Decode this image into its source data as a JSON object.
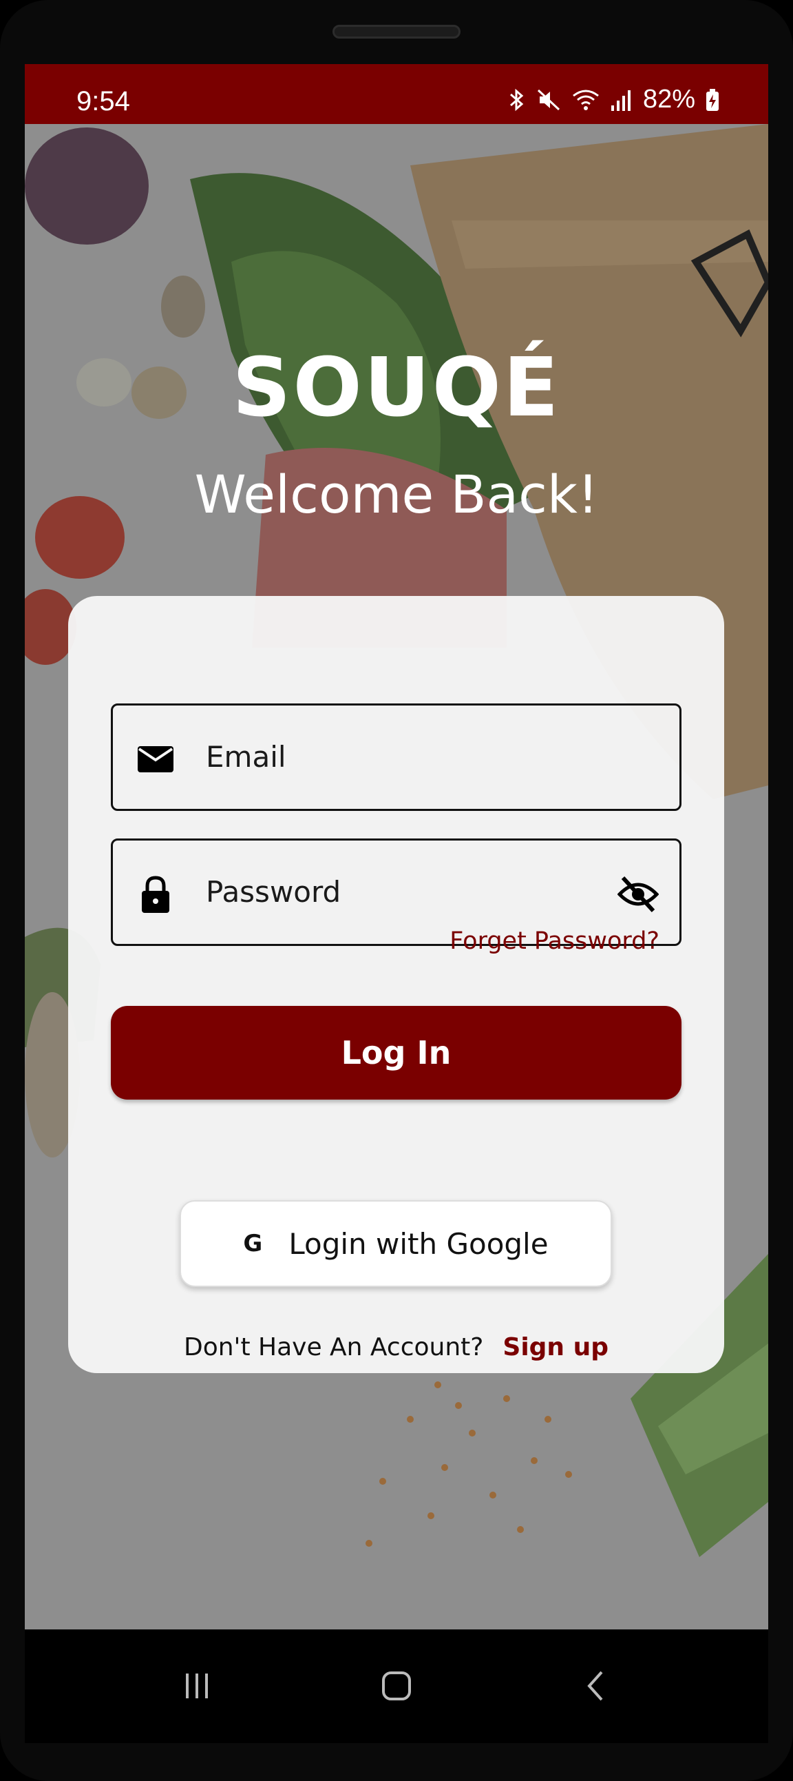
{
  "status_bar": {
    "time": "9:54",
    "battery": "82%",
    "icons": [
      "bluetooth-icon",
      "mute-icon",
      "wifi-icon",
      "signal-icon",
      "battery-charging-icon"
    ]
  },
  "brand": "SOUQÉ",
  "welcome": "Welcome Back!",
  "form": {
    "email_placeholder": "Email",
    "password_placeholder": "Password",
    "forgot_password": "Forget Password?",
    "login_button": "Log In",
    "google_icon_letter": "G",
    "google_button": "Login with Google",
    "no_account_text": "Don't Have An Account?",
    "signup_link": "Sign up"
  },
  "navigation": {
    "items": [
      "recent-apps-icon",
      "home-icon",
      "back-icon"
    ]
  },
  "colors": {
    "brand": "#7a0000",
    "card": "#f6f6f6",
    "text": "#111111"
  }
}
